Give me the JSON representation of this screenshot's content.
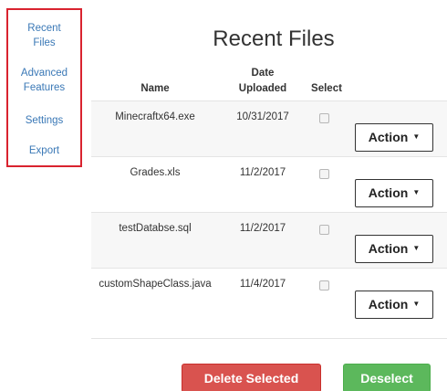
{
  "sidebar": {
    "items": [
      {
        "label_line1": "Recent",
        "label_line2": "Files"
      },
      {
        "label_line1": "Advanced",
        "label_line2": "Features"
      },
      {
        "label": "Settings"
      },
      {
        "label": "Export"
      }
    ]
  },
  "main": {
    "title": "Recent Files",
    "columns": {
      "name": "Name",
      "date_line1": "Date",
      "date_line2": "Uploaded",
      "select": "Select"
    },
    "rows": [
      {
        "name": "Minecraftx64.exe",
        "date": "10/31/2017",
        "selected": false,
        "action_label": "Action"
      },
      {
        "name": "Grades.xls",
        "date": "11/2/2017",
        "selected": false,
        "action_label": "Action"
      },
      {
        "name": "testDatabse.sql",
        "date": "11/2/2017",
        "selected": false,
        "action_label": "Action"
      },
      {
        "name": "customShapeClass.java",
        "date": "11/4/2017",
        "selected": false,
        "action_label": "Action"
      }
    ],
    "caret_icon": "caret-down-icon"
  },
  "footer": {
    "delete_label": "Delete Selected",
    "deselect_label": "Deselect"
  },
  "colors": {
    "sidebar_border": "#d9232f",
    "link": "#3a78b6",
    "danger": "#d9534f",
    "success": "#5cb85c"
  }
}
